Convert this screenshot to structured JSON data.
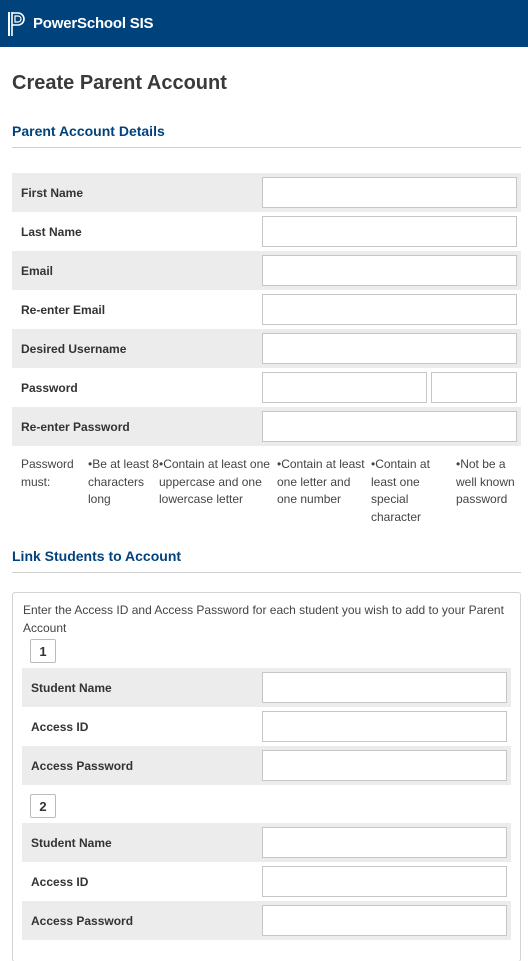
{
  "header": {
    "brand": "PowerSchool SIS",
    "brand_color": "#00427c",
    "logo_icon": "powerschool-logo-icon"
  },
  "page": {
    "title": "Create Parent Account"
  },
  "parent_section": {
    "title": "Parent Account Details",
    "fields": [
      {
        "label": "First Name",
        "value": "",
        "shaded": true
      },
      {
        "label": "Last Name",
        "value": "",
        "shaded": false
      },
      {
        "label": "Email",
        "value": "",
        "shaded": true
      },
      {
        "label": "Re-enter Email",
        "value": "",
        "shaded": false
      },
      {
        "label": "Desired Username",
        "value": "",
        "shaded": true
      },
      {
        "label": "Password",
        "value": "",
        "shaded": false
      },
      {
        "label": "Re-enter Password",
        "value": "",
        "shaded": true
      }
    ]
  },
  "password_rules": {
    "intro": "Password must:",
    "rules": [
      "•Be at least 8 characters long",
      "•Contain at least one uppercase and one lowercase letter",
      "•Contain at least one letter and one number",
      "•Contain at least one special character",
      "•Not be a well known password"
    ]
  },
  "link_section": {
    "title": "Link Students to Account",
    "instructions": "Enter the Access ID and Access Password for each student you wish to add to your Parent Account",
    "students": [
      {
        "number": "1",
        "fields": [
          {
            "label": "Student Name",
            "value": ""
          },
          {
            "label": "Access ID",
            "value": ""
          },
          {
            "label": "Access Password",
            "value": ""
          }
        ]
      },
      {
        "number": "2",
        "fields": [
          {
            "label": "Student Name",
            "value": ""
          },
          {
            "label": "Access ID",
            "value": ""
          },
          {
            "label": "Access Password",
            "value": ""
          }
        ]
      }
    ]
  }
}
